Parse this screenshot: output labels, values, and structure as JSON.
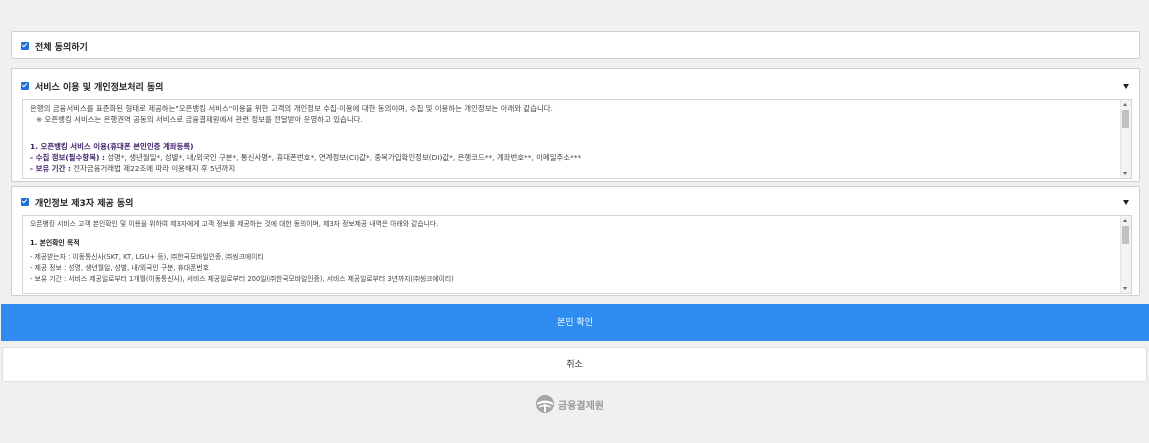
{
  "agree_all": {
    "label": "전체 동의하기",
    "checked": true
  },
  "section1": {
    "title": "서비스 이용 및 개인정보처리 동의",
    "checked": true,
    "lines": [
      "은행의 금융서비스를 표준화된 형태로 제공하는\"오픈뱅킹 서비스\"이용을 위한 고객의 개인정보 수집·이용에 대한 동의이며, 수집 및 이용하는 개인정보는 아래와 같습니다.",
      "※ 오픈뱅킹 서비스는 은행권역 공동의 서비스로 금융결제원에서 관련 정보를 전달받아 운영하고 있습니다.",
      "1. 오픈뱅킹 서비스 이용(휴대폰 본인인증 계좌등록)",
      "- 수집 정보(필수항목) :",
      " 성명*, 생년월일*, 성별*, 내/외국인 구분*, 통신사명*, 휴대폰번호*, 연계정보(CI)값*, 중복가입확인정보(DI)값*, 은행코드**, 계좌번호**, 이메일주소***",
      "- 보유 기간 :",
      " 전자금융거래법 제22조에 따라 이용해지 후 5년까지"
    ]
  },
  "section2": {
    "title": "개인정보 제3자 제공 동의",
    "checked": true,
    "lines": [
      "오픈뱅킹 서비스 고객 본인확인 및 이용을 위하여 제3자에게 고객 정보를 제공하는 것에 대한 동의이며, 제3자 정보제공 내역은 아래와 같습니다.",
      "1. 본인확인 목적",
      "- 제공받는자 : 이동통신사(SKT, KT, LGU+ 등), ㈜한국모바일인증, ㈜씽크에이티",
      "- 제공 정보 : 성명, 생년월일, 성별, 내/외국인 구분, 휴대폰번호",
      "- 보유 기간 : 서비스 제공일로부터 1개월(이동통신사), 서비스 제공일로부터 200일(㈜한국모바일인증), 서비스 제공일로부터 3년까지(㈜씽크에이티)"
    ]
  },
  "buttons": {
    "confirm": "본인 확인",
    "cancel": "취소"
  },
  "footer": {
    "logo_text": "금융결제원"
  },
  "colors": {
    "primary": "#2f8cf0",
    "checkbox": "#1e6fd9",
    "background": "#f0f0f0"
  },
  "icons": {
    "dropdown": "chevron-down-icon",
    "checkbox": "checkbox-checked-icon",
    "logo": "kftc-logo-icon"
  }
}
